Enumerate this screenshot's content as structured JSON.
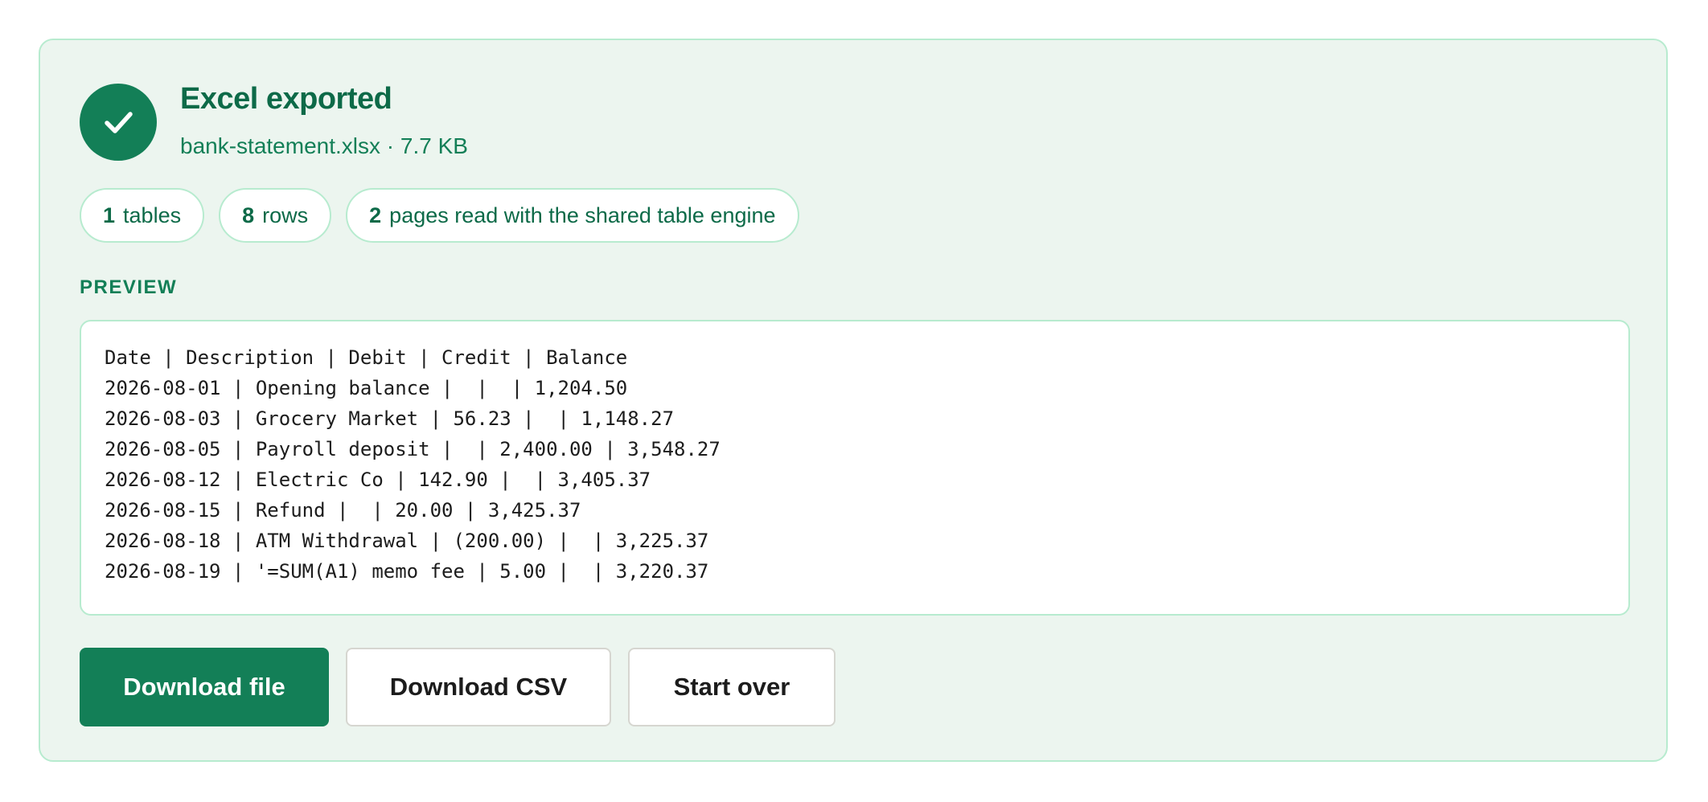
{
  "result": {
    "title": "Excel exported",
    "file_info": "bank-statement.xlsx · 7.7 KB"
  },
  "stats": [
    {
      "value": "1",
      "label": "tables"
    },
    {
      "value": "8",
      "label": "rows"
    },
    {
      "value": "2",
      "label": "pages read with the shared table engine"
    }
  ],
  "preview": {
    "label": "PREVIEW",
    "lines": [
      "Date | Description | Debit | Credit | Balance",
      "2026-08-01 | Opening balance |  |  | 1,204.50",
      "2026-08-03 | Grocery Market | 56.23 |  | 1,148.27",
      "2026-08-05 | Payroll deposit |  | 2,400.00 | 3,548.27",
      "2026-08-12 | Electric Co | 142.90 |  | 3,405.37",
      "2026-08-15 | Refund |  | 20.00 | 3,425.37",
      "2026-08-18 | ATM Withdrawal | (200.00) |  | 3,225.37",
      "2026-08-19 | '=SUM(A1) memo fee | 5.00 |  | 3,220.37"
    ]
  },
  "actions": {
    "download_file": "Download file",
    "download_csv": "Download CSV",
    "start_over": "Start over"
  },
  "colors": {
    "accent": "#137f57",
    "card_background": "#ecf5ef",
    "border": "#b7ebcf"
  },
  "icons": {
    "status": "check-icon"
  }
}
